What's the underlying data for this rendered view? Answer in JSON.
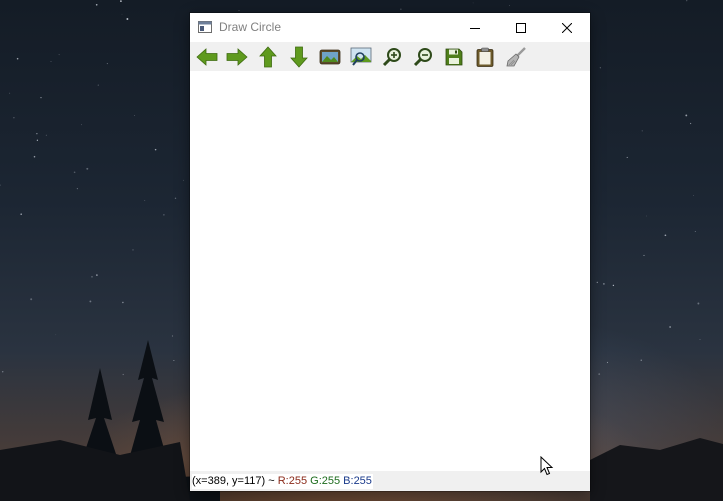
{
  "window": {
    "title": "Draw Circle"
  },
  "toolbar": {
    "buttons": [
      {
        "name": "pan-left",
        "icon": "arrow-left-icon"
      },
      {
        "name": "pan-right",
        "icon": "arrow-right-icon"
      },
      {
        "name": "pan-up",
        "icon": "arrow-up-icon"
      },
      {
        "name": "pan-down",
        "icon": "arrow-down-icon"
      },
      {
        "name": "fit-image",
        "icon": "image-icon"
      },
      {
        "name": "zoom-region",
        "icon": "zoom-region-icon"
      },
      {
        "name": "zoom-in",
        "icon": "zoom-in-icon"
      },
      {
        "name": "zoom-out",
        "icon": "zoom-out-icon"
      },
      {
        "name": "save",
        "icon": "floppy-disk-icon"
      },
      {
        "name": "copy",
        "icon": "clipboard-icon"
      },
      {
        "name": "properties",
        "icon": "brush-icon"
      }
    ]
  },
  "status": {
    "coords": "(x=389, y=117) ~",
    "r": "R:255",
    "g": "G:255",
    "b": "B:255"
  },
  "colors": {
    "toolbar_green": "#5f9a1e",
    "toolbar_bg": "#f0f0f0",
    "title_gray": "#808080"
  }
}
